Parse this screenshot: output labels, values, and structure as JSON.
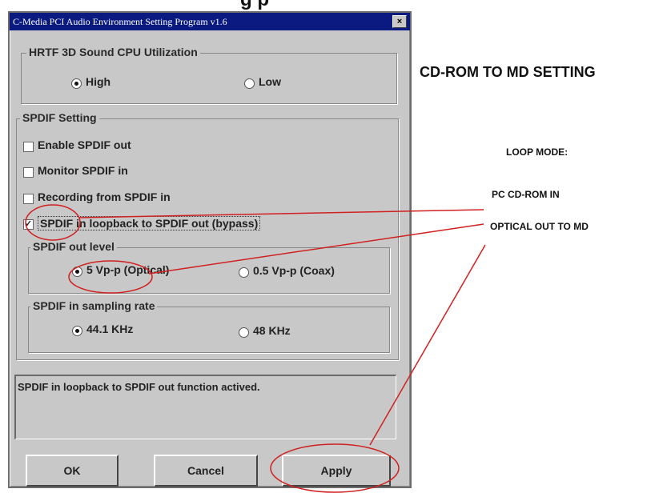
{
  "top_heading_fragment": "g p",
  "dialog": {
    "title": "C-Media PCI Audio Environment Setting Program v1.6",
    "close_glyph": "×",
    "hrtf": {
      "legend": "HRTF 3D Sound CPU Utilization",
      "options": [
        {
          "label": "High",
          "selected": true
        },
        {
          "label": "Low",
          "selected": false
        }
      ]
    },
    "spdif": {
      "legend": "SPDIF Setting",
      "checkboxes": [
        {
          "label": "Enable SPDIF out",
          "checked": false
        },
        {
          "label": "Monitor SPDIF in",
          "checked": false
        },
        {
          "label": "Recording from SPDIF in",
          "checked": false
        },
        {
          "label": "SPDIF in loopback to SPDIF out (bypass)",
          "checked": true
        }
      ],
      "out_level": {
        "legend": "SPDIF out level",
        "options": [
          {
            "label": "5 Vp-p (Optical)",
            "selected": true
          },
          {
            "label": "0.5 Vp-p (Coax)",
            "selected": false
          }
        ]
      },
      "sampling": {
        "legend": "SPDIF in sampling rate",
        "options": [
          {
            "label": "44.1 KHz",
            "selected": true
          },
          {
            "label": "48 KHz",
            "selected": false
          }
        ]
      }
    },
    "status_message": "SPDIF in loopback to SPDIF out function actived.",
    "buttons": {
      "ok": "OK",
      "cancel": "Cancel",
      "apply": "Apply"
    }
  },
  "annotations": {
    "heading": "CD-ROM TO MD SETTING",
    "loop_mode": "LOOP MODE:",
    "pc_cdrom_in": "PC CD-ROM IN",
    "optical_out": "OPTICAL OUT TO MD"
  },
  "colors": {
    "titlebar": "#0a1a80",
    "dialog_face": "#c8c8c8",
    "annotation_red": "#d02020"
  }
}
